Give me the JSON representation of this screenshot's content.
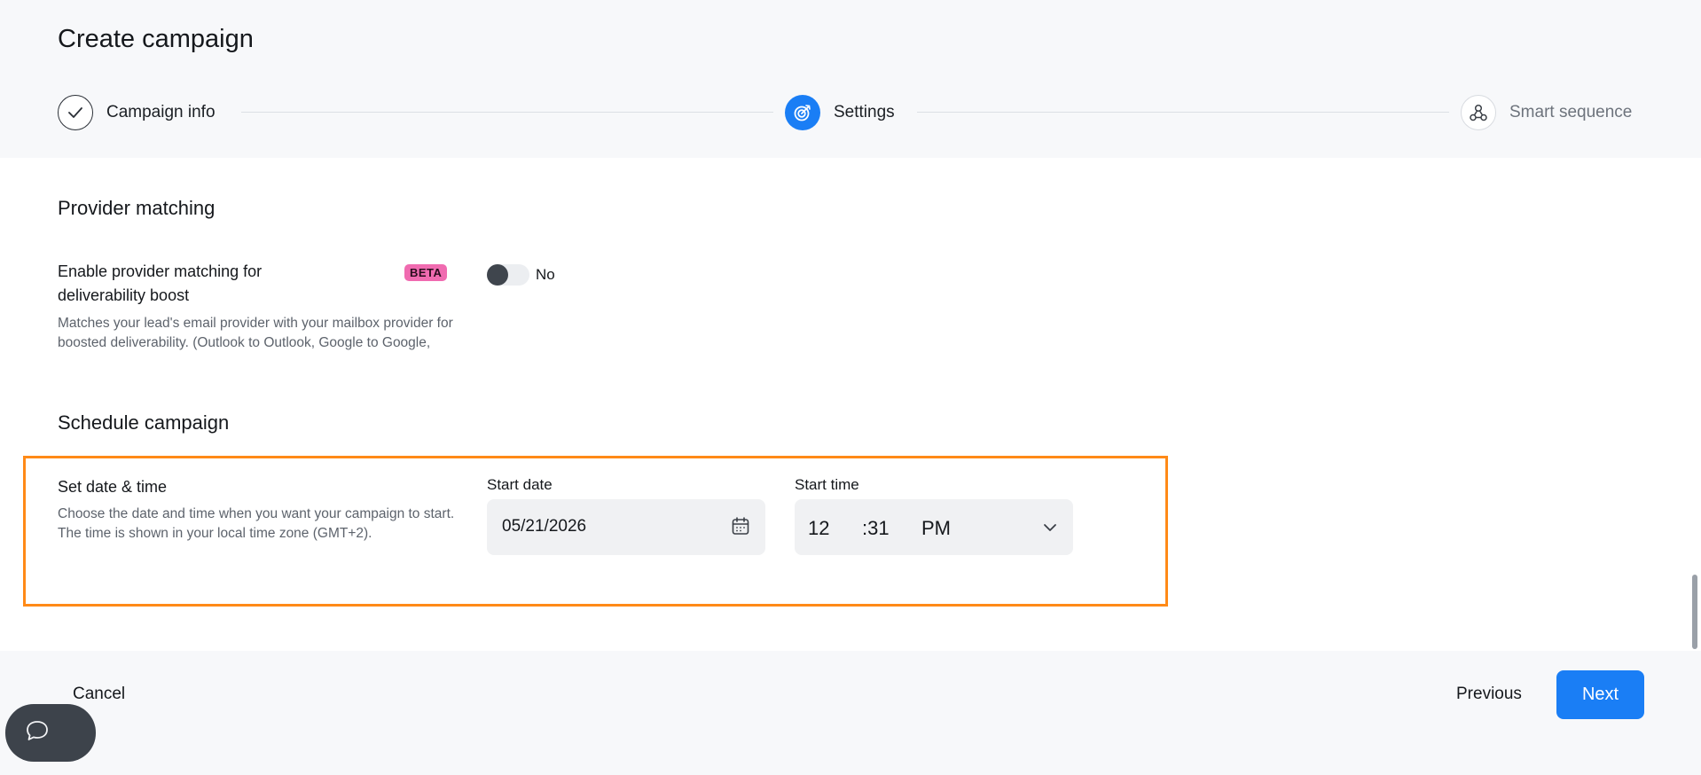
{
  "page": {
    "title": "Create campaign"
  },
  "stepper": {
    "steps": [
      {
        "label": "Campaign info",
        "state": "completed",
        "icon": "check-icon"
      },
      {
        "label": "Settings",
        "state": "active",
        "icon": "target-icon"
      },
      {
        "label": "Smart sequence",
        "state": "upcoming",
        "icon": "sequence-icon"
      }
    ]
  },
  "provider_matching": {
    "section_title": "Provider matching",
    "field_title": "Enable provider matching for deliverability boost",
    "badge": "BETA",
    "description": "Matches your lead's email provider with your mailbox provider for boosted deliverability. (Outlook to Outlook, Google to Google,",
    "toggle_label": "No",
    "toggle_on": false
  },
  "schedule": {
    "section_title": "Schedule campaign",
    "field_title": "Set date & time",
    "description": "Choose the date and time when you want your campaign to start. The time is shown in your local time zone (GMT+2).",
    "start_date_label": "Start date",
    "start_date_value": "05/21/2026",
    "start_time_label": "Start time",
    "time_hour": "12",
    "time_minute": ":31",
    "time_period": "PM"
  },
  "footer": {
    "cancel_label": "Cancel",
    "previous_label": "Previous",
    "next_label": "Next"
  },
  "colors": {
    "accent": "#1a7ef5",
    "highlight": "#ff8a17",
    "beta_badge": "#f06bb0"
  }
}
